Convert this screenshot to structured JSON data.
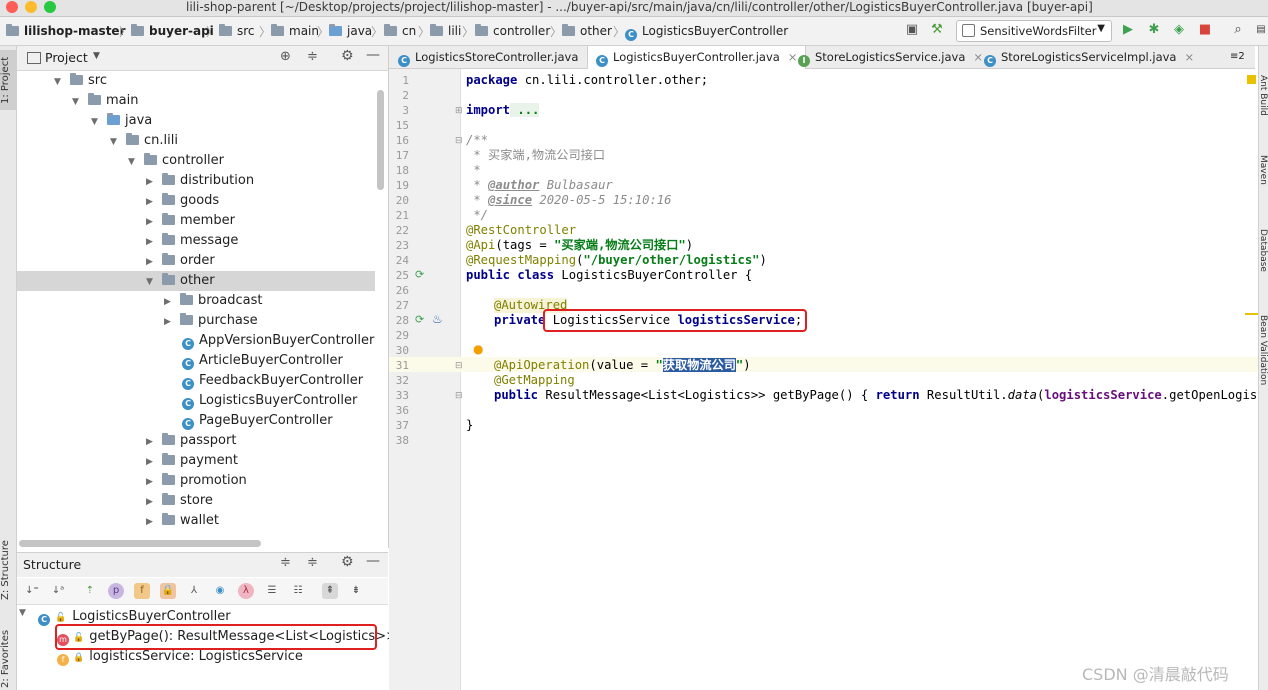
{
  "window": {
    "title": "lili-shop-parent [~/Desktop/projects/project/lilishop-master] - .../buyer-api/src/main/java/cn/lili/controller/other/LogisticsBuyerController.java [buyer-api]"
  },
  "breadcrumb": [
    "lilishop-master",
    "buyer-api",
    "src",
    "main",
    "java",
    "cn",
    "lili",
    "controller",
    "other",
    "LogisticsBuyerController"
  ],
  "run_config": {
    "selected": "SensitiveWordsFilter"
  },
  "left_strip": {
    "project_tab": "1: Project",
    "structure_tab": "Z: Structure",
    "favorites_tab": "2: Favorites"
  },
  "project_panel": {
    "title": "Project",
    "tree": [
      {
        "label": "src",
        "type": "folder",
        "expanded": true
      },
      {
        "label": "main",
        "type": "folder",
        "expanded": true
      },
      {
        "label": "java",
        "type": "folder",
        "expanded": true
      },
      {
        "label": "cn.lili",
        "type": "folder",
        "expanded": true
      },
      {
        "label": "controller",
        "type": "folder",
        "expanded": true
      },
      {
        "label": "distribution",
        "type": "folder",
        "expanded": false
      },
      {
        "label": "goods",
        "type": "folder",
        "expanded": false
      },
      {
        "label": "member",
        "type": "folder",
        "expanded": false
      },
      {
        "label": "message",
        "type": "folder",
        "expanded": false
      },
      {
        "label": "order",
        "type": "folder",
        "expanded": false
      },
      {
        "label": "other",
        "type": "folder",
        "expanded": true,
        "selected": true
      },
      {
        "label": "broadcast",
        "type": "folder",
        "expanded": false
      },
      {
        "label": "purchase",
        "type": "folder",
        "expanded": false
      },
      {
        "label": "AppVersionBuyerController",
        "type": "class"
      },
      {
        "label": "ArticleBuyerController",
        "type": "class"
      },
      {
        "label": "FeedbackBuyerController",
        "type": "class"
      },
      {
        "label": "LogisticsBuyerController",
        "type": "class"
      },
      {
        "label": "PageBuyerController",
        "type": "class"
      },
      {
        "label": "passport",
        "type": "folder",
        "expanded": false
      },
      {
        "label": "payment",
        "type": "folder",
        "expanded": false
      },
      {
        "label": "promotion",
        "type": "folder",
        "expanded": false
      },
      {
        "label": "store",
        "type": "folder",
        "expanded": false
      },
      {
        "label": "wallet",
        "type": "folder",
        "expanded": false
      }
    ]
  },
  "structure_panel": {
    "title": "Structure",
    "root": "LogisticsBuyerController",
    "items": [
      {
        "label": "getByPage(): ResultMessage<List<Logistics>>",
        "kind": "method"
      },
      {
        "label": "logisticsService: LogisticsService",
        "kind": "field"
      }
    ]
  },
  "editor": {
    "tabs": [
      {
        "label": "LogisticsStoreController.java",
        "icon": "class-icon",
        "active": false
      },
      {
        "label": "LogisticsBuyerController.java",
        "icon": "class-icon",
        "active": true
      },
      {
        "label": "StoreLogisticsService.java",
        "icon": "interface-icon",
        "active": false
      },
      {
        "label": "StoreLogisticsServiceImpl.java",
        "icon": "class-icon",
        "active": false
      }
    ],
    "tab_overflow": "≡2",
    "line_numbers": [
      "1",
      "2",
      "3",
      "15",
      "16",
      "17",
      "18",
      "19",
      "20",
      "21",
      "22",
      "23",
      "24",
      "25",
      "26",
      "27",
      "28",
      "29",
      "30",
      "31",
      "32",
      "33",
      "36",
      "37",
      "38"
    ],
    "code": {
      "l1a": "package",
      "l1b": " cn.lili.controller.other;",
      "l3a": "import",
      "l3b": " ...",
      "l15": "/**",
      "l16": " * 买家端,物流公司接口",
      "l17": " *",
      "l18a": " * ",
      "l18b": "@author",
      "l18c": " Bulbasaur",
      "l19a": " * ",
      "l19b": "@since",
      "l19c": " 2020-05-5 15:10:16",
      "l20": " */",
      "l21": "@RestController",
      "l22a": "@Api",
      "l22b": "(tags = ",
      "l22c": "\"买家端,物流公司接口\"",
      "l22d": ")",
      "l23a": "@RequestMapping",
      "l23b": "(",
      "l23c": "\"/buyer/other/logistics\"",
      "l23d": ")",
      "l24a": "public class",
      "l24b": " LogisticsBuyerController {",
      "l27": "@Autowired",
      "l28a": "private",
      "l28b": " LogisticsService ",
      "l28c": "logisticsService",
      "l28d": ";",
      "l31a": "@ApiOperation",
      "l31b": "(value = ",
      "l31c": "\"",
      "l31d": "获取物流公司",
      "l31e": "\"",
      "l31f": ")",
      "l32": "@GetMapping",
      "l33a": "public",
      "l33b": " ResultMessage<List<Logistics>> getByPage() { ",
      "l33c": "return",
      "l33d": " ResultUtil.",
      "l33e": "data",
      "l33f": "(",
      "l33g": "logisticsService",
      "l33h": ".getOpenLogistics(",
      "l37": "}"
    }
  },
  "right_strip": {
    "labels": [
      "Ant Build",
      "Maven",
      "Database",
      "Bean Validation"
    ]
  },
  "watermark": "CSDN @清晨敲代码",
  "colors": {
    "highlight_box": "#e02020",
    "keyword": "#00008b",
    "string": "#067d17",
    "annotation": "#808000"
  }
}
